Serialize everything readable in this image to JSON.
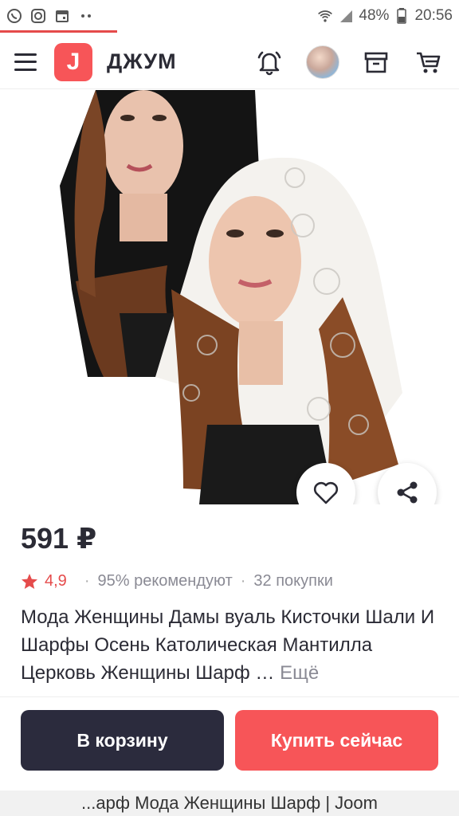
{
  "status_bar": {
    "icons": [
      "whatsapp-icon",
      "instagram-icon",
      "calendar-icon",
      "more-dots-icon"
    ],
    "battery": "48%",
    "time": "20:56"
  },
  "header": {
    "logo_glyph": "J",
    "brand": "ДЖУМ",
    "icons": [
      "bell-icon",
      "avatar",
      "box-icon",
      "cart-icon"
    ]
  },
  "product": {
    "price": "591 ₽",
    "rating": "4,9",
    "recommend": "95% рекомендуют",
    "purchases": "32 покупки",
    "title": "Мода Женщины Дамы вуаль Кисточки Шали И Шарфы Осень Католическая Мантилла Церковь Женщины Шарф …",
    "more": "Ещё"
  },
  "actions": {
    "add_to_cart": "В корзину",
    "buy_now": "Купить сейчас"
  },
  "url_bar": {
    "text": "...арф Мода Женщины Шарф | Joom"
  },
  "colors": {
    "accent": "#f75558",
    "dark": "#2b2b3d",
    "rating": "#e54b4b"
  }
}
